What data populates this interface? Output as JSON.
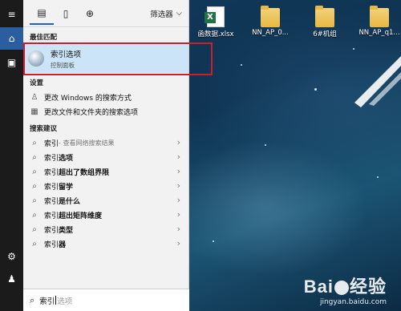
{
  "desktop": {
    "icons": [
      {
        "type": "excel",
        "label": "函数据.xlsx"
      },
      {
        "type": "folder",
        "label": "NN_AP_0..."
      },
      {
        "type": "folder",
        "label": "6#机组"
      },
      {
        "type": "folder",
        "label": "NN_AP_q1..."
      }
    ],
    "watermark_brand": "Bai经验",
    "watermark_url": "jingyan.baidu.com"
  },
  "sidebar": {
    "items": [
      {
        "icon": "hamburger-icon"
      },
      {
        "icon": "home-icon"
      },
      {
        "icon": "notebook-icon"
      },
      {
        "icon": "gear-icon"
      },
      {
        "icon": "user-feedback-icon"
      }
    ]
  },
  "toolbar": {
    "tabs": [
      {
        "icon": "all-apps-icon"
      },
      {
        "icon": "document-icon"
      },
      {
        "icon": "web-globe-icon"
      }
    ],
    "filter_label": "筛选器"
  },
  "best_match": {
    "heading": "最佳匹配",
    "title": "索引选项",
    "subtitle": "控制面板"
  },
  "settings": {
    "heading": "设置",
    "items": [
      "更改 Windows 的搜索方式",
      "更改文件和文件夹的搜索选项"
    ]
  },
  "suggestions": {
    "heading": "搜索建议",
    "items": [
      {
        "bold": "索引",
        "muted": " - 查看网络搜索结果"
      },
      {
        "bold": "索引",
        "rest": "选项"
      },
      {
        "bold": "索引",
        "rest": "超出了数组界限"
      },
      {
        "bold": "索引",
        "rest": "留学"
      },
      {
        "bold": "索引",
        "rest": "是什么"
      },
      {
        "bold": "索引",
        "rest": "超出矩阵维度"
      },
      {
        "bold": "索引",
        "rest": "类型"
      },
      {
        "bold": "索引",
        "rest": "器"
      }
    ]
  },
  "search": {
    "typed": "索引",
    "placeholder_rest": "选项"
  },
  "colors": {
    "selection": "#cce4f7",
    "highlight_border": "#d21c2a",
    "active_sidebar": "#2b5e9e"
  }
}
